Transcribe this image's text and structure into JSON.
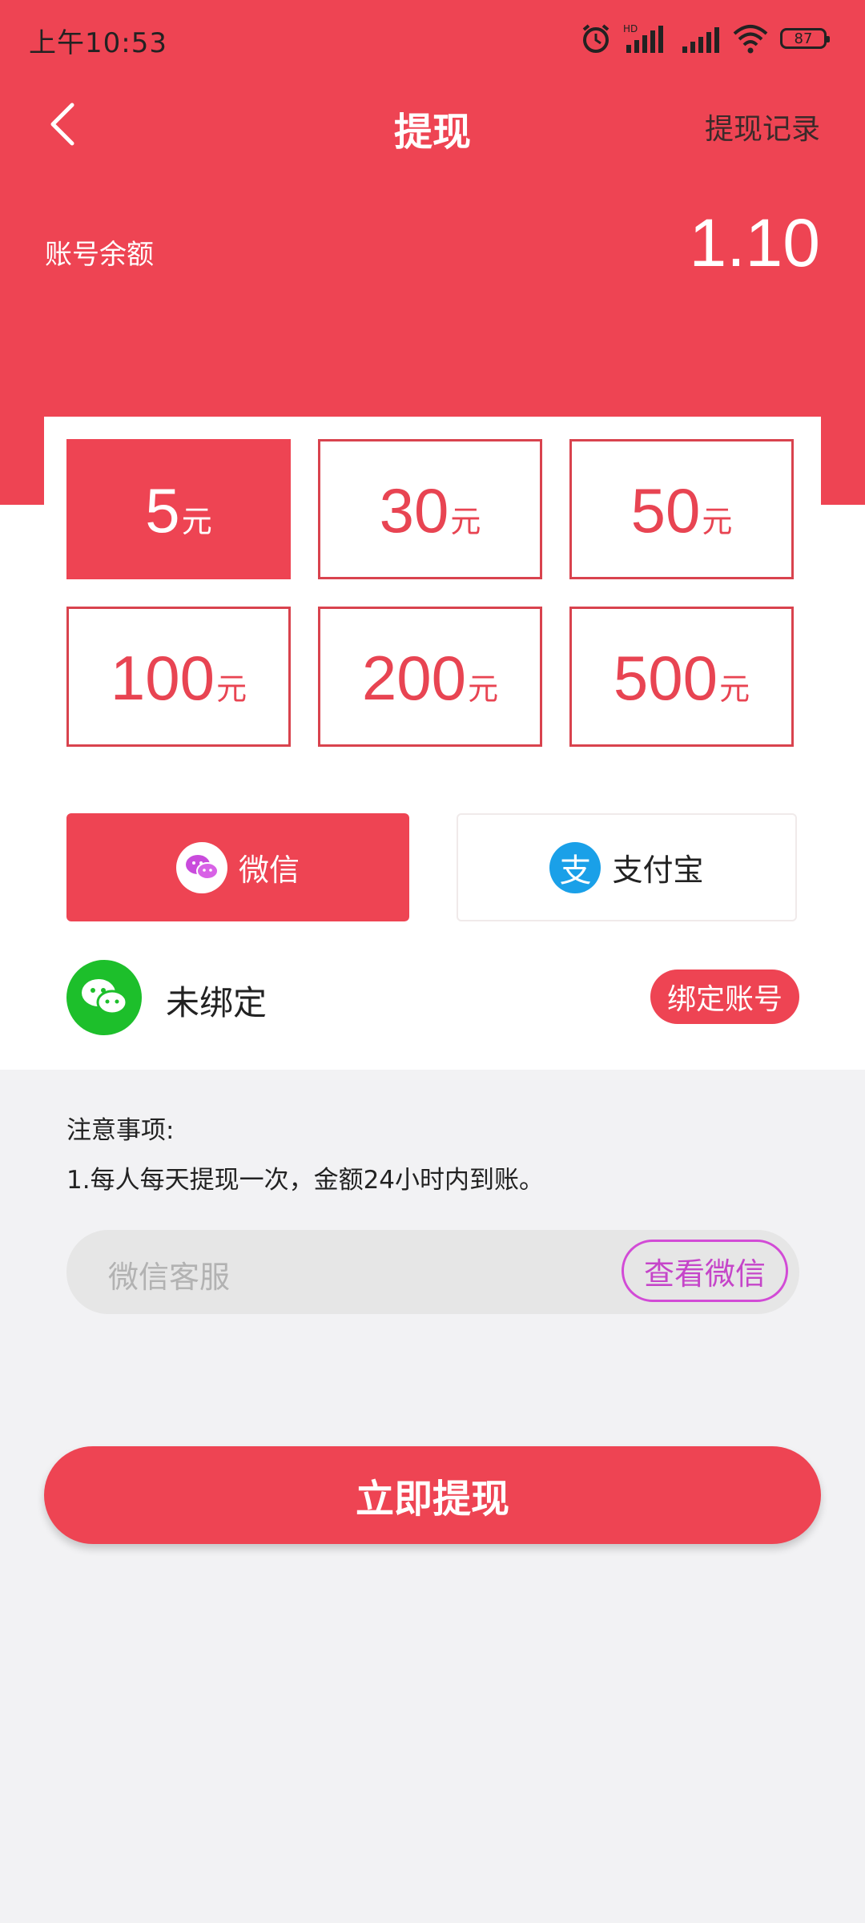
{
  "status_bar": {
    "time": "上午10:53",
    "battery": "87",
    "hd_label": "HD"
  },
  "header": {
    "title": "提现",
    "record_link": "提现记录",
    "balance_label": "账号余额",
    "balance_value": "1.10"
  },
  "amounts": [
    {
      "value": "5",
      "unit": "元",
      "selected": true
    },
    {
      "value": "30",
      "unit": "元",
      "selected": false
    },
    {
      "value": "50",
      "unit": "元",
      "selected": false
    },
    {
      "value": "100",
      "unit": "元",
      "selected": false
    },
    {
      "value": "200",
      "unit": "元",
      "selected": false
    },
    {
      "value": "500",
      "unit": "元",
      "selected": false
    }
  ],
  "payment": {
    "wechat_label": "微信",
    "alipay_label": "支付宝",
    "alipay_glyph": "支"
  },
  "binding": {
    "status": "未绑定",
    "button": "绑定账号"
  },
  "notes": {
    "title": "注意事项:",
    "line1": "1.每人每天提现一次，金额24小时内到账。"
  },
  "service": {
    "label": "微信客服",
    "button": "查看微信"
  },
  "withdraw_button": "立即提现",
  "colors": {
    "primary": "#ee4453",
    "background": "#f2f2f4",
    "wechat_green": "#1dbf2b",
    "alipay_blue": "#1aa0e8",
    "service_purple": "#d24bd6"
  }
}
